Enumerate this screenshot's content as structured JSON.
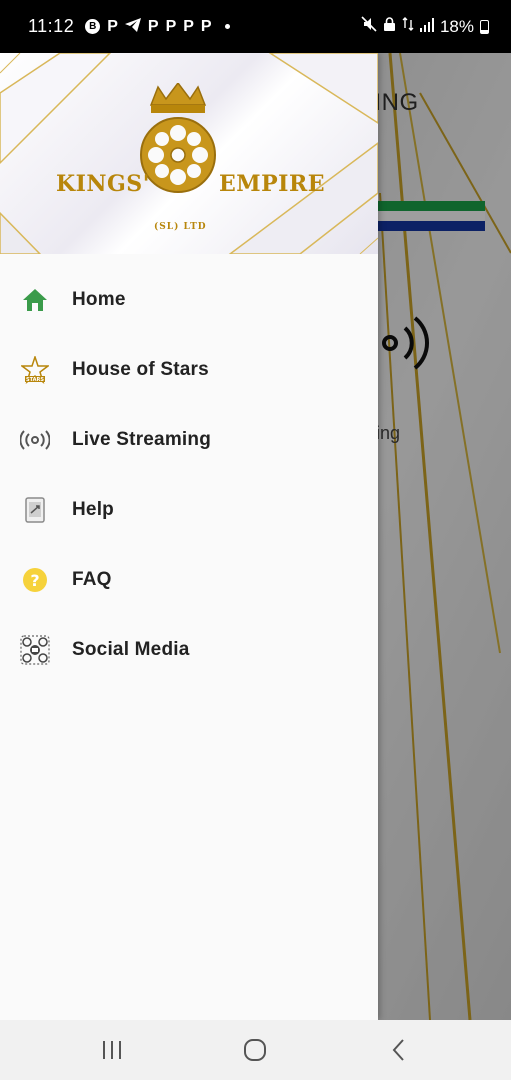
{
  "status_bar": {
    "time": "11:12",
    "notification_icons": [
      "P",
      "P",
      "P",
      "P",
      "P",
      "P"
    ],
    "battery": "18%"
  },
  "background_app": {
    "title": "E VOTING",
    "streaming_label": "reaming",
    "flag_colors": [
      "#1aa34a",
      "#1436a3"
    ]
  },
  "drawer": {
    "logo": {
      "left_text": "KINGS'",
      "right_text": "EMPIRE",
      "sub_text": "(SL) LTD"
    },
    "items": [
      {
        "label": "Home",
        "icon": "home-icon"
      },
      {
        "label": "House of Stars",
        "icon": "star-icon"
      },
      {
        "label": "Live Streaming",
        "icon": "radio-icon"
      },
      {
        "label": "Help",
        "icon": "help-doc-icon"
      },
      {
        "label": "FAQ",
        "icon": "question-icon"
      },
      {
        "label": "Social Media",
        "icon": "social-media-icon"
      }
    ]
  },
  "colors": {
    "gold": "#b8860b",
    "home_green": "#3a9b4a",
    "faq_yellow": "#f6d23b"
  }
}
